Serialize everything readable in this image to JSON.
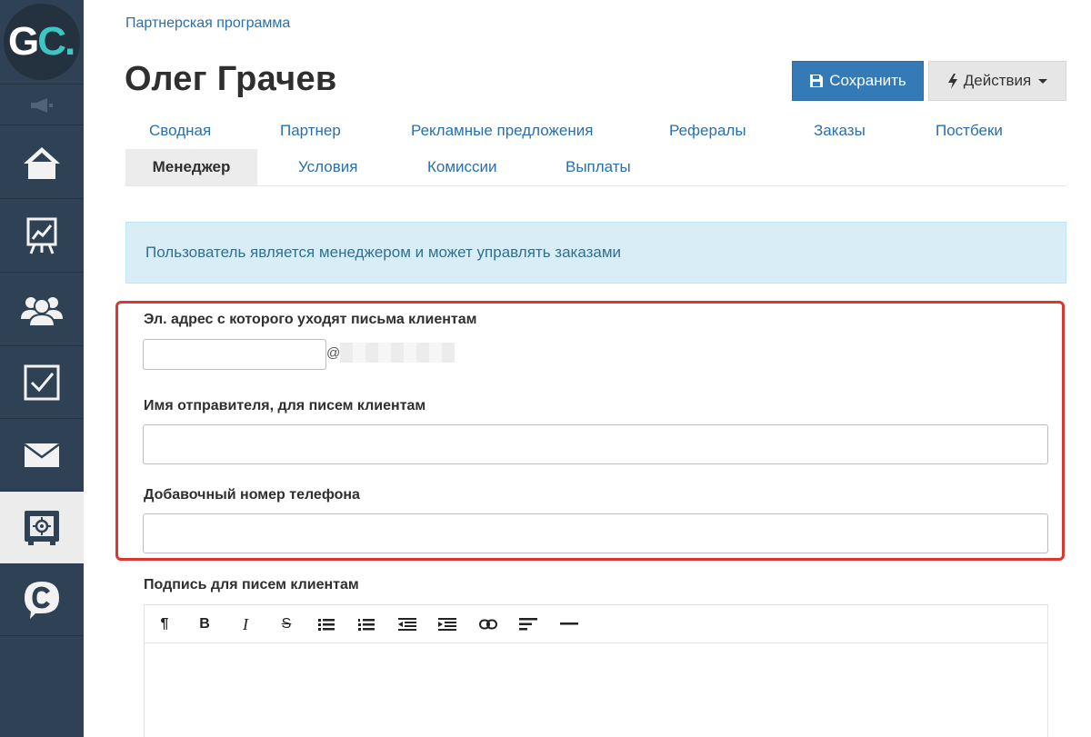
{
  "sidebar": {
    "logo": {
      "letter_g": "G",
      "letter_c": "C",
      "dot": "."
    },
    "items": [
      {
        "icon": "megaphone-icon"
      },
      {
        "icon": "home-icon"
      },
      {
        "icon": "chart-board-icon"
      },
      {
        "icon": "users-group-icon"
      },
      {
        "icon": "checkbox-icon"
      },
      {
        "icon": "mail-icon"
      },
      {
        "icon": "safe-settings-icon",
        "active": true
      },
      {
        "icon": "chat-c-icon"
      }
    ]
  },
  "breadcrumb": "Партнерская программа",
  "page_title": "Олег Грачев",
  "toolbar": {
    "save_label": "Сохранить",
    "actions_label": "Действия"
  },
  "tabs": {
    "row1": [
      "Сводная",
      "Партнер",
      "Рекламные предложения",
      "Рефералы",
      "Заказы",
      "Постбеки"
    ],
    "row2": [
      "Менеджер",
      "Условия",
      "Комиссии",
      "Выплаты"
    ],
    "active": "Менеджер"
  },
  "alert_text": "Пользователь является менеджером и может управлять заказами",
  "form": {
    "email_label": "Эл. адрес с которого уходят письма клиентам",
    "email_value": "",
    "at_sign": "@",
    "sender_label": "Имя отправителя, для писем клиентам",
    "sender_value": "",
    "phone_label": "Добавочный номер телефона",
    "phone_value": "",
    "signature_label": "Подпись для писем клиентам"
  },
  "editor_toolbar": {
    "paragraph": "¶",
    "bold": "B",
    "italic": "I",
    "strike": "S"
  },
  "colors": {
    "sidebar_bg": "#2f4154",
    "accent_blue": "#337ab7",
    "logo_teal": "#3ec7c2",
    "highlight_red": "#d9372f",
    "alert_bg": "#d9edf7"
  }
}
